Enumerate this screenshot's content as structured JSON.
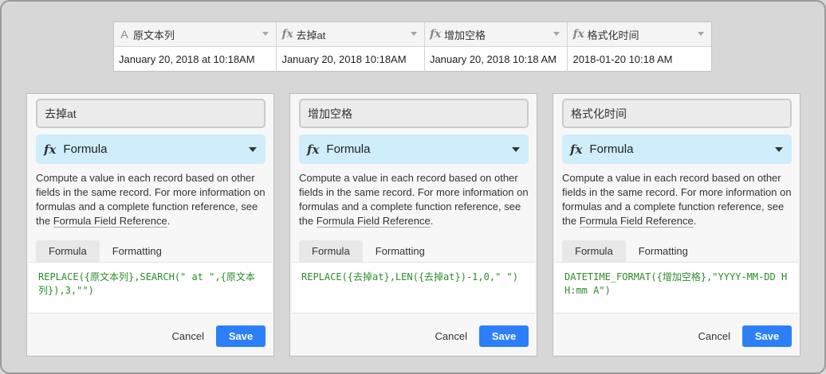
{
  "grid": {
    "columns": [
      {
        "icon": "text-type-icon",
        "glyph": "A",
        "label": "原文本列"
      },
      {
        "icon": "formula-type-icon",
        "glyph": "fx",
        "label": "去掉at"
      },
      {
        "icon": "formula-type-icon",
        "glyph": "fx",
        "label": "增加空格"
      },
      {
        "icon": "formula-type-icon",
        "glyph": "fx",
        "label": "格式化时间"
      }
    ],
    "row": [
      "January 20, 2018 at 10:18AM",
      "January 20, 2018 10:18AM",
      "January 20, 2018 10:18 AM",
      "2018-01-20 10:18 AM"
    ]
  },
  "panels": [
    {
      "field_name": "去掉at",
      "type_glyph": "fx",
      "type_label": "Formula",
      "desc": "Compute a value in each record based on other fields in the same record. For more information on formulas and a complete function reference, see the ",
      "desc_link": "Formula Field Reference",
      "desc_end": ".",
      "tab_formula": "Formula",
      "tab_formatting": "Formatting",
      "formula": "REPLACE({原文本列},SEARCH(\" at \",{原文本列}),3,\"\")",
      "cancel": "Cancel",
      "save": "Save"
    },
    {
      "field_name": "增加空格",
      "type_glyph": "fx",
      "type_label": "Formula",
      "desc": "Compute a value in each record based on other fields in the same record. For more information on formulas and a complete function reference, see the ",
      "desc_link": "Formula Field Reference",
      "desc_end": ".",
      "tab_formula": "Formula",
      "tab_formatting": "Formatting",
      "formula": "REPLACE({去掉at},LEN({去掉at})-1,0,\" \")",
      "cancel": "Cancel",
      "save": "Save"
    },
    {
      "field_name": "格式化时间",
      "type_glyph": "fx",
      "type_label": "Formula",
      "desc": "Compute a value in each record based on other fields in the same record. For more information on formulas and a complete function reference, see the ",
      "desc_link": "Formula Field Reference",
      "desc_end": ".",
      "tab_formula": "Formula",
      "tab_formatting": "Formatting",
      "formula": "DATETIME_FORMAT({增加空格},\"YYYY-MM-DD HH:mm A\")",
      "cancel": "Cancel",
      "save": "Save"
    }
  ],
  "colors": {
    "accent": "#2d7ff9",
    "type_select_bg": "#cfedfb",
    "formula_text": "#2e8b2e"
  }
}
